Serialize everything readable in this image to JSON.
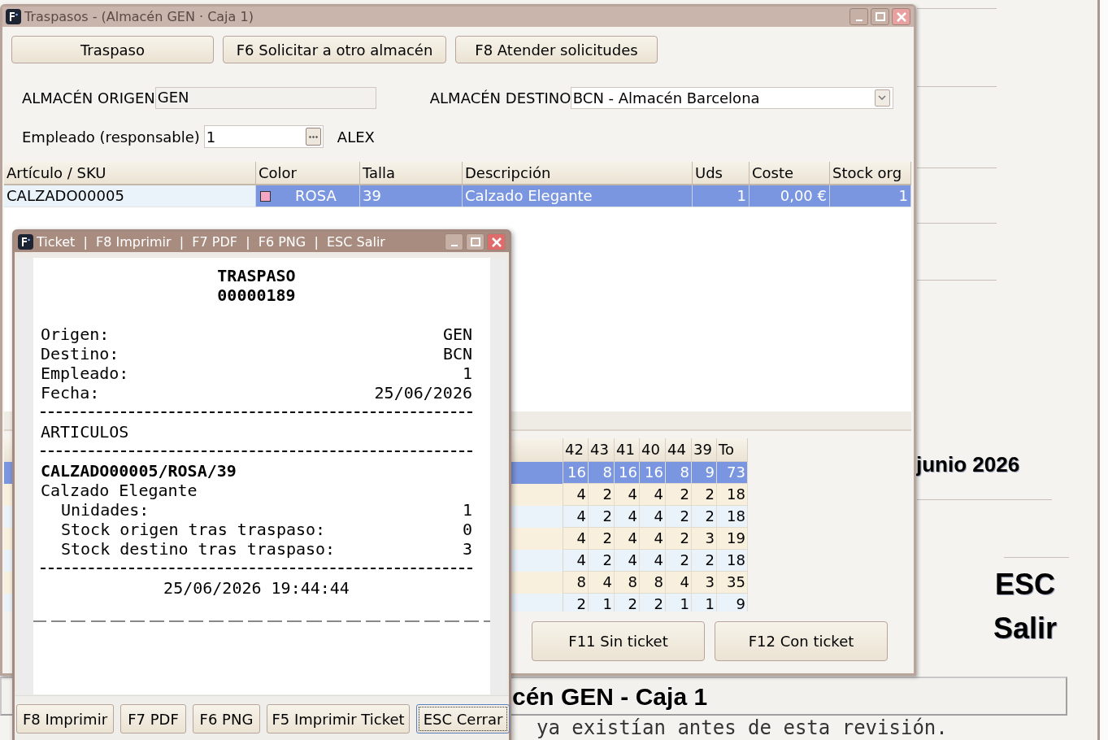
{
  "background_app": {
    "month_label": "junio 2026",
    "shortcut_key": "ESC",
    "shortcut_label": "Salir",
    "header_bar": "cén GEN - Caja 1",
    "footer_text": "ya existían antes de esta revisión."
  },
  "main_window": {
    "title": "Traspasos - (Almacén GEN · Caja 1)",
    "active": false,
    "mode_buttons": [
      "Traspaso",
      "F6 Solicitar a otro almacén",
      "F8 Atender solicitudes"
    ],
    "origin": {
      "label": "ALMACÉN ORIGEN",
      "value": "GEN"
    },
    "destination": {
      "label": "ALMACÉN DESTINO",
      "value": "BCN - Almacén Barcelona"
    },
    "employee": {
      "label": "Empleado (responsable)",
      "value": "1",
      "name": "ALEX"
    },
    "table": {
      "columns": [
        "Artículo / SKU",
        "Color",
        "Talla",
        "Descripción",
        "Uds",
        "Coste",
        "Stock org"
      ],
      "rows": [
        {
          "selected": true,
          "color": "#f4a6c4",
          "cells": [
            "CALZADO00005",
            "ROSA",
            "39",
            "Calzado Elegante",
            "1",
            "0,00 €",
            "1"
          ]
        }
      ]
    },
    "size_grid": {
      "columns": [
        "42",
        "43",
        "41",
        "40",
        "44",
        "39",
        "To"
      ],
      "rows": [
        {
          "selected": true,
          "values": [
            "16",
            "8",
            "16",
            "16",
            "8",
            "9",
            "73"
          ]
        },
        {
          "selected": false,
          "values": [
            "4",
            "2",
            "4",
            "4",
            "2",
            "2",
            "18"
          ]
        },
        {
          "selected": false,
          "values": [
            "4",
            "2",
            "4",
            "4",
            "2",
            "2",
            "18"
          ]
        },
        {
          "selected": false,
          "values": [
            "4",
            "2",
            "4",
            "4",
            "2",
            "3",
            "19"
          ]
        },
        {
          "selected": false,
          "values": [
            "4",
            "2",
            "4",
            "4",
            "2",
            "2",
            "18"
          ]
        },
        {
          "selected": false,
          "values": [
            "8",
            "4",
            "8",
            "8",
            "4",
            "3",
            "35"
          ]
        },
        {
          "selected": false,
          "values": [
            "2",
            "1",
            "2",
            "2",
            "1",
            "1",
            "9"
          ]
        }
      ]
    },
    "actions": [
      "F11 Sin ticket",
      "F12 Con ticket"
    ]
  },
  "ticket_window": {
    "title": "Ticket  |  F8 Imprimir  |  F7 PDF  |  F6 PNG  |  ESC Salir",
    "active": true,
    "lines": [
      {
        "kind": "title",
        "text": "TRASPASO"
      },
      {
        "kind": "title",
        "text": "00000189"
      },
      {
        "kind": "spacer"
      },
      {
        "kind": "pair",
        "label": "Origen:",
        "value": "GEN"
      },
      {
        "kind": "pair",
        "label": "Destino:",
        "value": "BCN"
      },
      {
        "kind": "pair",
        "label": "Empleado:",
        "value": "1"
      },
      {
        "kind": "pair",
        "label": "Fecha:",
        "value": "25/06/2026"
      },
      {
        "kind": "separator"
      },
      {
        "kind": "text",
        "text": "ARTICULOS"
      },
      {
        "kind": "separator"
      },
      {
        "kind": "bold",
        "text": "CALZADO00005/ROSA/39"
      },
      {
        "kind": "text",
        "text": "Calzado Elegante"
      },
      {
        "kind": "indented_pair",
        "label": "Unidades:",
        "value": "1"
      },
      {
        "kind": "indented_pair",
        "label": "Stock origen tras traspaso:",
        "value": "0"
      },
      {
        "kind": "indented_pair",
        "label": "Stock destino tras traspaso:",
        "value": "3"
      },
      {
        "kind": "separator"
      },
      {
        "kind": "center",
        "text": "25/06/2026 19:44:44"
      }
    ],
    "buttons": [
      {
        "label": "F8 Imprimir",
        "focused": false
      },
      {
        "label": "F7 PDF",
        "focused": false
      },
      {
        "label": "F6 PNG",
        "focused": false
      },
      {
        "label": "F5 Imprimir Ticket",
        "focused": false
      },
      {
        "label": "ESC Cerrar",
        "focused": true
      }
    ]
  }
}
